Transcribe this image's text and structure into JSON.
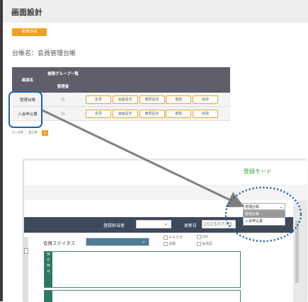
{
  "header": {
    "title": "画面設計"
  },
  "new_button": "新規作成",
  "ledger": {
    "label": "台帳名：会員管理台帳"
  },
  "table": {
    "col_screen": "画面名",
    "col_perm_group": "権限グループ一覧",
    "col_admin": "管理者",
    "rows": [
      {
        "name": "管理台帳",
        "admin": "○",
        "actions": [
          "変更",
          "画面設定",
          "権限設定",
          "複製",
          "削除"
        ]
      },
      {
        "name": "入会申込書",
        "admin": "○",
        "actions": [
          "変更",
          "画面設定",
          "権限設定",
          "複製",
          "削除"
        ]
      }
    ]
  },
  "pager": {
    "summary": "1～2件 ／全2件",
    "current": "1"
  },
  "screenshot": {
    "mode": "登録モード",
    "staff_label": "登録担当者",
    "updated_label": "更新日",
    "updated_value": "2023/07/05",
    "status_label": "会員ステイタス",
    "checks": [
      "メルマガ",
      "DM",
      "会報",
      "会員証"
    ],
    "memo_tab": [
      "M",
      "E",
      "M",
      "O"
    ],
    "dropdown": {
      "selected": "管理台帳",
      "options": [
        "管理台帳",
        "入会申込書"
      ]
    }
  },
  "colors": {
    "accent": "#f0a020",
    "header_dark": "#5f5f6b",
    "highlight": "#1f5fa8",
    "green": "#3aa03a"
  }
}
